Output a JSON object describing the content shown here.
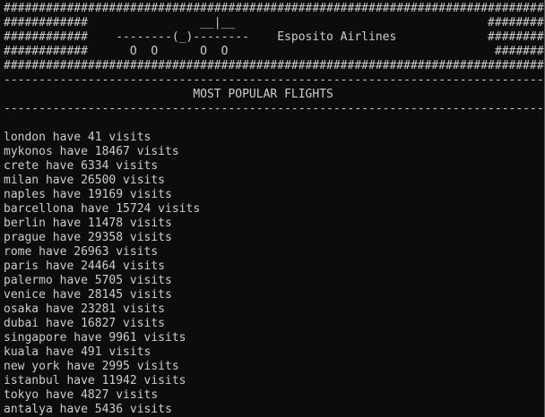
{
  "banner": [
    "##################################################################################",
    "############                __|__                                    ############",
    "############    --------(_)--------    Esposito Airlines             ############",
    "############      O  O      O  O                                      ############",
    "##################################################################################"
  ],
  "rule_top": "--------------------------------------------------------------------------------------",
  "heading": "                           MOST POPULAR FLIGHTS",
  "rule_bottom": "--------------------------------------------------------------------------------------",
  "blank": "",
  "flights": [
    "london have 41 visits",
    "mykonos have 18467 visits",
    "crete have 6334 visits",
    "milan have 26500 visits",
    "naples have 19169 visits",
    "barcellona have 15724 visits",
    "berlin have 11478 visits",
    "prague have 29358 visits",
    "rome have 26963 visits",
    "paris have 24464 visits",
    "palermo have 5705 visits",
    "venice have 28145 visits",
    "osaka have 23281 visits",
    "dubai have 16827 visits",
    "singapore have 9961 visits",
    "kuala have 491 visits",
    "new york have 2995 visits",
    "istanbul have 11942 visits",
    "tokyo have 4827 visits",
    "antalya have 5436 visits"
  ]
}
